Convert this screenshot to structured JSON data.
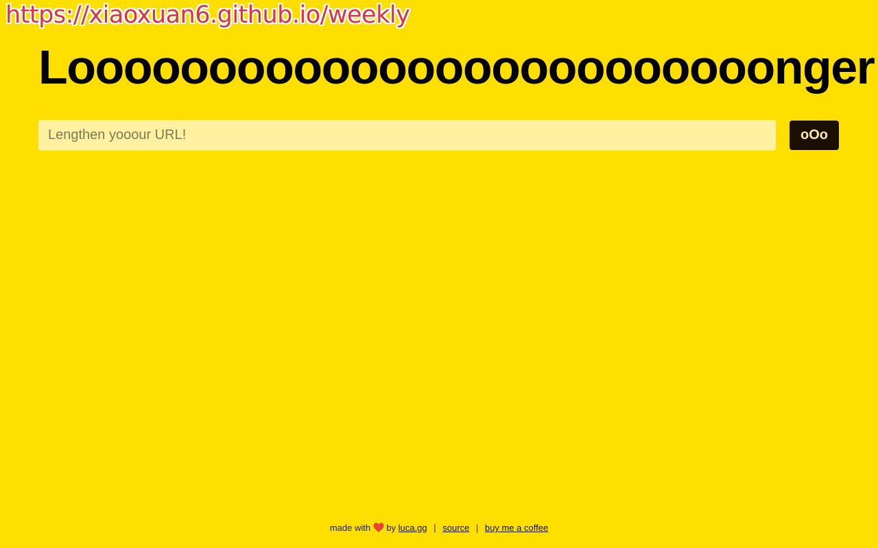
{
  "watermark": {
    "text": "https://xiaoxuan6.github.io/weekly"
  },
  "header": {
    "title": "Looooooooooooooooooooooooonger"
  },
  "form": {
    "input_value": "",
    "input_placeholder": "Lengthen yooour URL!",
    "submit_label": "oOo"
  },
  "footer": {
    "made_with": "made with",
    "heart_icon": "heart-icon",
    "by": "by",
    "author_link": "luca.gg",
    "separator": "|",
    "source_link": "source",
    "coffee_link": "buy me a coffee"
  },
  "colors": {
    "background": "#FFDF00",
    "input_background": "#FFF1A0",
    "button_background": "#1a0f00",
    "button_text": "#FFE9A6",
    "heart": "#e8413a",
    "watermark": "#d8353f"
  }
}
